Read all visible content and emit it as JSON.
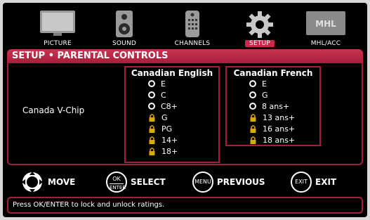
{
  "nav": {
    "items": [
      {
        "label": "PICTURE",
        "icon": "tv-icon"
      },
      {
        "label": "SOUND",
        "icon": "speaker-icon"
      },
      {
        "label": "CHANNELS",
        "icon": "remote-icon"
      },
      {
        "label": "SETUP",
        "icon": "gear-icon"
      },
      {
        "label": "MHL/ACC",
        "icon": "mhl-icon",
        "logo_text": "MHL"
      }
    ],
    "active": "SETUP"
  },
  "title": "SETUP • PARENTAL CONTROLS",
  "vchip_label": "Canada V-Chip",
  "english": {
    "title": "Canadian English",
    "ratings": [
      {
        "label": "E",
        "state": "unlocked"
      },
      {
        "label": "C",
        "state": "unlocked"
      },
      {
        "label": "C8+",
        "state": "unlocked"
      },
      {
        "label": "G",
        "state": "locked"
      },
      {
        "label": "PG",
        "state": "locked"
      },
      {
        "label": "14+",
        "state": "locked"
      },
      {
        "label": "18+",
        "state": "locked"
      }
    ]
  },
  "french": {
    "title": "Canadian French",
    "ratings": [
      {
        "label": "E",
        "state": "unlocked"
      },
      {
        "label": "G",
        "state": "unlocked"
      },
      {
        "label": "8 ans+",
        "state": "unlocked"
      },
      {
        "label": "13 ans+",
        "state": "locked"
      },
      {
        "label": "16 ans+",
        "state": "locked"
      },
      {
        "label": "18 ans+",
        "state": "locked"
      }
    ]
  },
  "hints": {
    "move": "MOVE",
    "ok_btn_top": "OK",
    "ok_btn_bottom": "ENTER",
    "select": "SELECT",
    "menu_btn": "MENU",
    "previous": "PREVIOUS",
    "exit_btn": "EXIT",
    "exit": "EXIT"
  },
  "status": "Press OK/ENTER to lock and unlock ratings.",
  "colors": {
    "accent": "#a71e3b",
    "lock": "#e0a800",
    "background": "#000000"
  }
}
